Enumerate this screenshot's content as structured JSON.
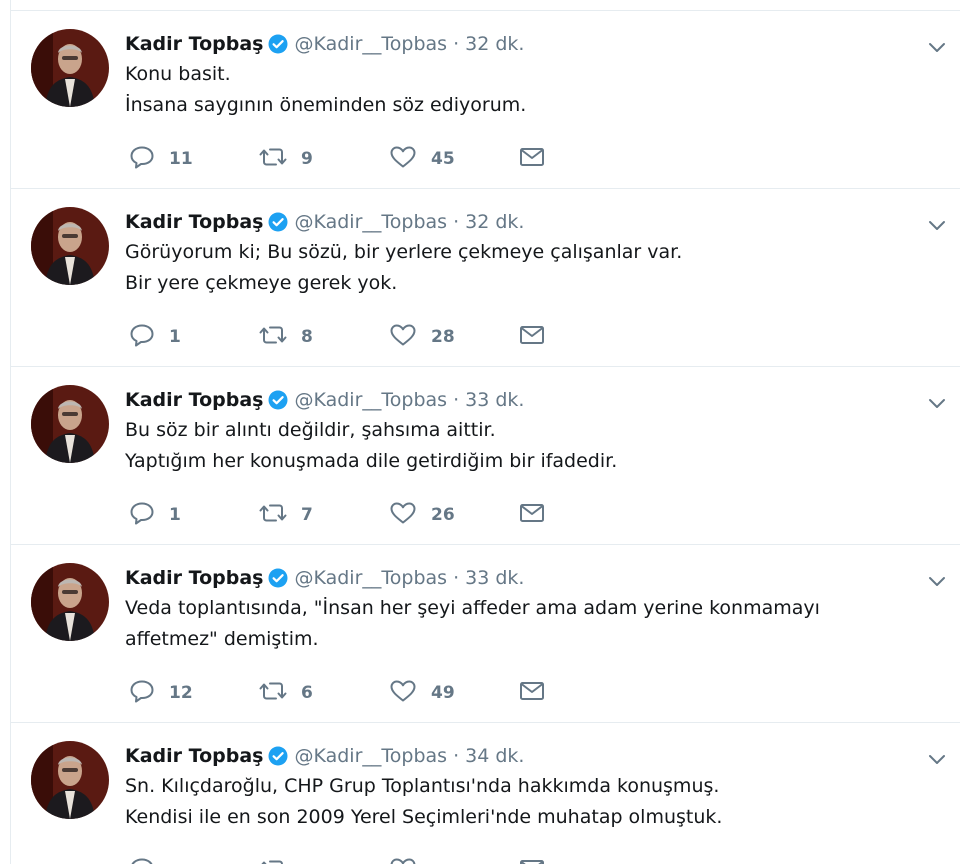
{
  "tweets": [
    {
      "name": "Kadir Topbaş",
      "handle": "@Kadir__Topbas",
      "separator": "·",
      "time": "32 dk.",
      "lines": [
        "Konu basit.",
        "İnsana saygının öneminden söz ediyorum."
      ],
      "replies": "11",
      "retweets": "9",
      "likes": "45"
    },
    {
      "name": "Kadir Topbaş",
      "handle": "@Kadir__Topbas",
      "separator": "·",
      "time": "32 dk.",
      "lines": [
        "Görüyorum ki; Bu sözü, bir yerlere çekmeye çalışanlar var.",
        "Bir yere çekmeye gerek yok."
      ],
      "replies": "1",
      "retweets": "8",
      "likes": "28"
    },
    {
      "name": "Kadir Topbaş",
      "handle": "@Kadir__Topbas",
      "separator": "·",
      "time": "33 dk.",
      "lines": [
        "Bu söz bir alıntı değildir,  şahsıma aittir.",
        "Yaptığım her konuşmada dile getirdiğim bir ifadedir."
      ],
      "replies": "1",
      "retweets": "7",
      "likes": "26"
    },
    {
      "name": "Kadir Topbaş",
      "handle": "@Kadir__Topbas",
      "separator": "·",
      "time": "33 dk.",
      "lines": [
        "Veda toplantısında, \"İnsan her şeyi affeder ama adam yerine konmamayı",
        "affetmez\" demiştim."
      ],
      "replies": "12",
      "retweets": "6",
      "likes": "49"
    },
    {
      "name": "Kadir Topbaş",
      "handle": "@Kadir__Topbas",
      "separator": "·",
      "time": "34 dk.",
      "lines": [
        "Sn. Kılıçdaroğlu, CHP Grup Toplantısı'nda hakkımda konuşmuş.",
        "Kendisi ile en son 2009 Yerel Seçimleri'nde muhatap olmuştuk."
      ],
      "replies": "",
      "retweets": "",
      "likes": ""
    }
  ],
  "icons": {
    "verified": "verified-badge-icon",
    "chevron": "chevron-down-icon",
    "reply": "reply-icon",
    "retweet": "retweet-icon",
    "like": "heart-icon",
    "dm": "envelope-icon"
  },
  "colors": {
    "verified": "#1da1f2",
    "meta": "#657786",
    "text": "#14171a",
    "divider": "#e6ecf0"
  }
}
